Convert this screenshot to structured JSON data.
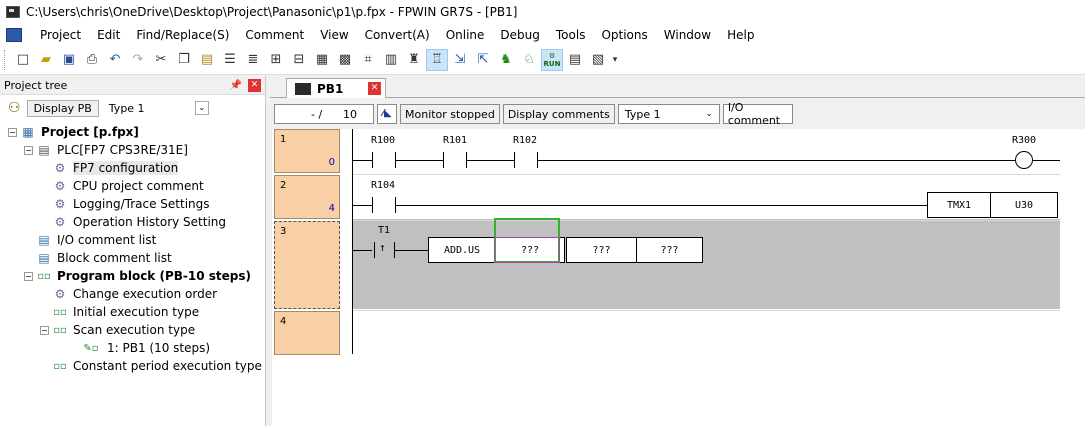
{
  "window": {
    "title": "C:\\Users\\chris\\OneDrive\\Desktop\\Project\\Panasonic\\p1\\p.fpx - FPWIN GR7S - [PB1]"
  },
  "menu": [
    "Project",
    "Edit",
    "Find/Replace(S)",
    "Comment",
    "View",
    "Convert(A)",
    "Online",
    "Debug",
    "Tools",
    "Options",
    "Window",
    "Help"
  ],
  "toolbar": {
    "run_label": "RUN"
  },
  "project_tree": {
    "title": "Project tree",
    "display_pb": "Display PB",
    "type_value": "Type 1",
    "items": [
      {
        "label": "Project [p.fpx]",
        "bold": true
      },
      {
        "label": "PLC[FP7 CPS3RE/31E]"
      },
      {
        "label": "FP7 configuration"
      },
      {
        "label": "CPU project comment"
      },
      {
        "label": "Logging/Trace Settings"
      },
      {
        "label": "Operation History Setting"
      },
      {
        "label": "I/O comment list"
      },
      {
        "label": "Block comment list"
      },
      {
        "label": "Program block (PB-10 steps)",
        "bold": true
      },
      {
        "label": "Change execution order"
      },
      {
        "label": "Initial execution type"
      },
      {
        "label": "Scan execution type"
      },
      {
        "label": "1: PB1 (10 steps)"
      },
      {
        "label": "Constant period execution type"
      }
    ]
  },
  "tab": {
    "label": "PB1"
  },
  "editor_bar": {
    "step_sep": "- /",
    "step_value": "10",
    "monitor_status": "Monitor stopped",
    "display_comments": "Display comments",
    "type_value": "Type 1",
    "io_comment": "I/O comment"
  },
  "ladder": {
    "rungs": [
      {
        "number": "1",
        "step": "0"
      },
      {
        "number": "2",
        "step": "4"
      },
      {
        "number": "3",
        "step": ""
      },
      {
        "number": "4",
        "step": ""
      }
    ],
    "rung1": {
      "c1": "R100",
      "c2": "R101",
      "c3": "R102",
      "coil": "R300"
    },
    "rung2": {
      "c1": "R104",
      "timer": "TMX1",
      "timer_val": "U30"
    },
    "rung3": {
      "c1": "T1",
      "instr": "ADD.US",
      "op1": "???",
      "op2": "???",
      "op3": "???"
    }
  }
}
